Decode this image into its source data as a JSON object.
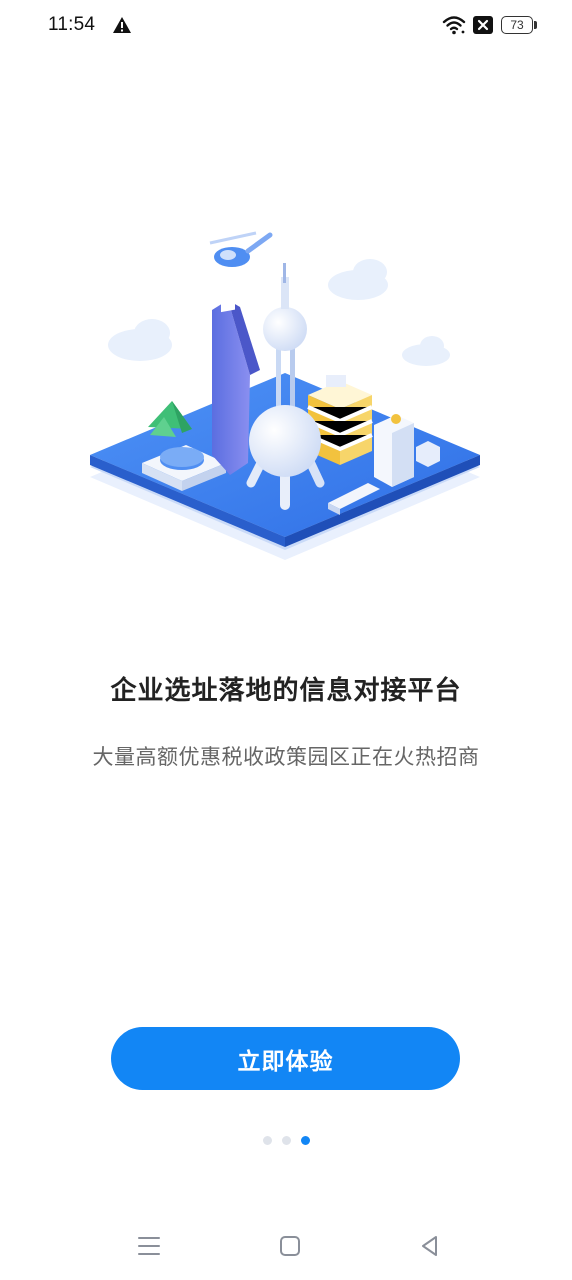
{
  "status_bar": {
    "time": "11:54",
    "battery": "73",
    "icons": [
      "warning-icon",
      "wifi-icon",
      "sim-off-icon",
      "battery-icon"
    ]
  },
  "illustration": {
    "icon": "city-isometric-illustration"
  },
  "onboarding": {
    "title": "企业选址落地的信息对接平台",
    "subtitle": "大量高额优惠税收政策园区正在火热招商",
    "cta_label": "立即体验",
    "page_count": 3,
    "current_page": 3
  },
  "nav_bar": {
    "icons": [
      "menu-icon",
      "home-icon",
      "back-icon"
    ]
  },
  "colors": {
    "accent": "#1286f5",
    "title": "#222222",
    "subtitle": "#666666",
    "dot_inactive": "#dfe3ea"
  }
}
